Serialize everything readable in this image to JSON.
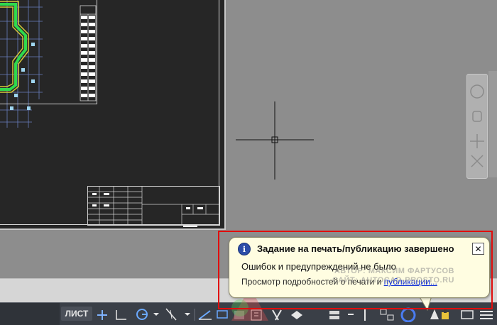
{
  "sheet": {
    "stamp_label": "Зкон"
  },
  "notification": {
    "title": "Задание на печать/публикацию завершено",
    "message": "Ошибок и предупреждений не было",
    "link_prefix": "Просмотр подробностей о печати и ",
    "link_text": "публикации...",
    "close_label": "✕",
    "icon": "info-icon"
  },
  "watermark": {
    "line1": "АВТОР: МАКСИМ ФАРТУСОВ",
    "line2": "САЙТ: AUTOCAD-PROSTO.RU"
  },
  "statusbar": {
    "space_label": "ЛИСТ",
    "icons": [
      "grid-icon",
      "snap-icon",
      "ortho-icon",
      "polar-icon",
      "osnap-icon",
      "otrack-icon",
      "lineweight-icon",
      "transparency-icon",
      "selection-cycling-icon",
      "annotation-icon",
      "workspace-icon",
      "isolate-icon",
      "hardware-acceleration-icon",
      "clean-screen-icon",
      "customization-icon"
    ]
  },
  "colors": {
    "highlight": "#e10d0d",
    "balloon_bg": "#fffde1",
    "link": "#0b2bd6",
    "info_icon": "#2c4da8"
  }
}
